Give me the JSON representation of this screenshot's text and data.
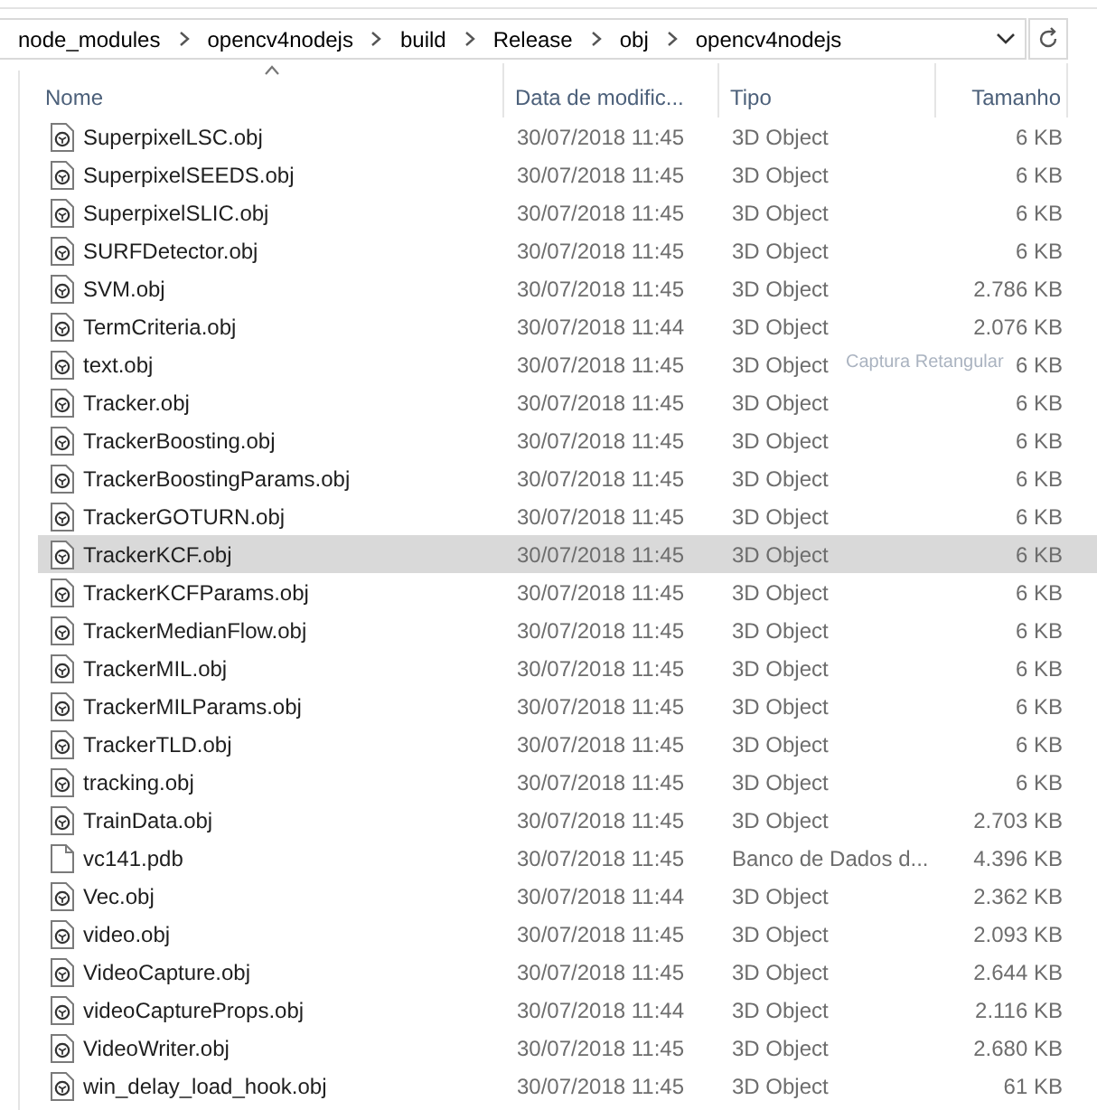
{
  "address_bar": {
    "segments": [
      "node_modules",
      "opencv4nodejs",
      "build",
      "Release",
      "obj",
      "opencv4nodejs"
    ]
  },
  "columns": [
    {
      "label": "Nome",
      "sorted": true
    },
    {
      "label": "Data de modific...",
      "sorted": false
    },
    {
      "label": "Tipo",
      "sorted": false
    },
    {
      "label": "Tamanho",
      "sorted": false
    }
  ],
  "files": [
    {
      "name": "SuperpixelLSC.obj",
      "date": "30/07/2018 11:45",
      "type": "3D Object",
      "size": "6 KB",
      "kind": "object",
      "selected": false
    },
    {
      "name": "SuperpixelSEEDS.obj",
      "date": "30/07/2018 11:45",
      "type": "3D Object",
      "size": "6 KB",
      "kind": "object",
      "selected": false
    },
    {
      "name": "SuperpixelSLIC.obj",
      "date": "30/07/2018 11:45",
      "type": "3D Object",
      "size": "6 KB",
      "kind": "object",
      "selected": false
    },
    {
      "name": "SURFDetector.obj",
      "date": "30/07/2018 11:45",
      "type": "3D Object",
      "size": "6 KB",
      "kind": "object",
      "selected": false
    },
    {
      "name": "SVM.obj",
      "date": "30/07/2018 11:45",
      "type": "3D Object",
      "size": "2.786 KB",
      "kind": "object",
      "selected": false
    },
    {
      "name": "TermCriteria.obj",
      "date": "30/07/2018 11:44",
      "type": "3D Object",
      "size": "2.076 KB",
      "kind": "object",
      "selected": false
    },
    {
      "name": "text.obj",
      "date": "30/07/2018 11:45",
      "type": "3D Object",
      "size": "6 KB",
      "kind": "object",
      "selected": false,
      "tooltip": "Captura Retangular"
    },
    {
      "name": "Tracker.obj",
      "date": "30/07/2018 11:45",
      "type": "3D Object",
      "size": "6 KB",
      "kind": "object",
      "selected": false
    },
    {
      "name": "TrackerBoosting.obj",
      "date": "30/07/2018 11:45",
      "type": "3D Object",
      "size": "6 KB",
      "kind": "object",
      "selected": false
    },
    {
      "name": "TrackerBoostingParams.obj",
      "date": "30/07/2018 11:45",
      "type": "3D Object",
      "size": "6 KB",
      "kind": "object",
      "selected": false
    },
    {
      "name": "TrackerGOTURN.obj",
      "date": "30/07/2018 11:45",
      "type": "3D Object",
      "size": "6 KB",
      "kind": "object",
      "selected": false
    },
    {
      "name": "TrackerKCF.obj",
      "date": "30/07/2018 11:45",
      "type": "3D Object",
      "size": "6 KB",
      "kind": "object",
      "selected": true
    },
    {
      "name": "TrackerKCFParams.obj",
      "date": "30/07/2018 11:45",
      "type": "3D Object",
      "size": "6 KB",
      "kind": "object",
      "selected": false
    },
    {
      "name": "TrackerMedianFlow.obj",
      "date": "30/07/2018 11:45",
      "type": "3D Object",
      "size": "6 KB",
      "kind": "object",
      "selected": false
    },
    {
      "name": "TrackerMIL.obj",
      "date": "30/07/2018 11:45",
      "type": "3D Object",
      "size": "6 KB",
      "kind": "object",
      "selected": false
    },
    {
      "name": "TrackerMILParams.obj",
      "date": "30/07/2018 11:45",
      "type": "3D Object",
      "size": "6 KB",
      "kind": "object",
      "selected": false
    },
    {
      "name": "TrackerTLD.obj",
      "date": "30/07/2018 11:45",
      "type": "3D Object",
      "size": "6 KB",
      "kind": "object",
      "selected": false
    },
    {
      "name": "tracking.obj",
      "date": "30/07/2018 11:45",
      "type": "3D Object",
      "size": "6 KB",
      "kind": "object",
      "selected": false
    },
    {
      "name": "TrainData.obj",
      "date": "30/07/2018 11:45",
      "type": "3D Object",
      "size": "2.703 KB",
      "kind": "object",
      "selected": false
    },
    {
      "name": "vc141.pdb",
      "date": "30/07/2018 11:45",
      "type": "Banco de Dados d...",
      "size": "4.396 KB",
      "kind": "document",
      "selected": false
    },
    {
      "name": "Vec.obj",
      "date": "30/07/2018 11:44",
      "type": "3D Object",
      "size": "2.362 KB",
      "kind": "object",
      "selected": false
    },
    {
      "name": "video.obj",
      "date": "30/07/2018 11:45",
      "type": "3D Object",
      "size": "2.093 KB",
      "kind": "object",
      "selected": false
    },
    {
      "name": "VideoCapture.obj",
      "date": "30/07/2018 11:45",
      "type": "3D Object",
      "size": "2.644 KB",
      "kind": "object",
      "selected": false
    },
    {
      "name": "videoCaptureProps.obj",
      "date": "30/07/2018 11:44",
      "type": "3D Object",
      "size": "2.116 KB",
      "kind": "object",
      "selected": false
    },
    {
      "name": "VideoWriter.obj",
      "date": "30/07/2018 11:45",
      "type": "3D Object",
      "size": "2.680 KB",
      "kind": "object",
      "selected": false
    },
    {
      "name": "win_delay_load_hook.obj",
      "date": "30/07/2018 11:45",
      "type": "3D Object",
      "size": "61 KB",
      "kind": "object",
      "selected": false
    }
  ]
}
